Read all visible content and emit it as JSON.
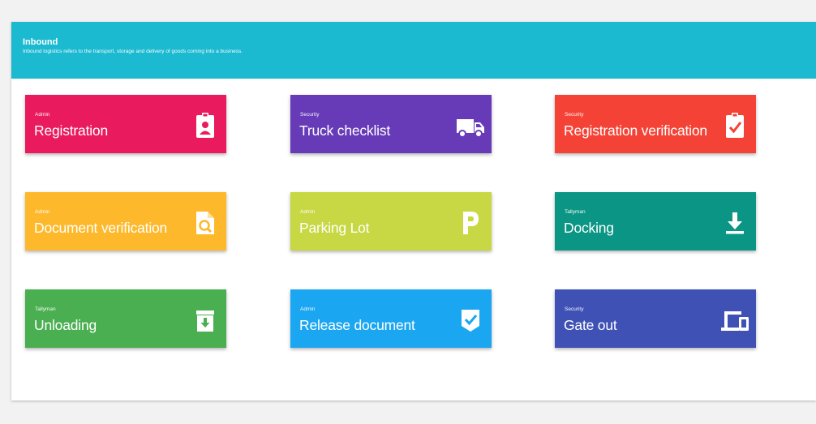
{
  "header": {
    "title": "Inbound",
    "subtitle": "Inbound logistics refers to the transport, storage and delivery of goods coming into a business."
  },
  "cards": [
    {
      "role": "Admin",
      "title": "Registration",
      "icon": "id-badge-icon",
      "color": "#e91a5d"
    },
    {
      "role": "Security",
      "title": "Truck checklist",
      "icon": "truck-icon",
      "color": "#673bb8"
    },
    {
      "role": "Security",
      "title": "Registration verification",
      "icon": "clipboard-check-icon",
      "color": "#f44336"
    },
    {
      "role": "Admin",
      "title": "Document verification",
      "icon": "document-search-icon",
      "color": "#fdb92b"
    },
    {
      "role": "Admin",
      "title": "Parking Lot",
      "icon": "parking-icon",
      "color": "#c7d844"
    },
    {
      "role": "Tallyman",
      "title": "Docking",
      "icon": "download-icon",
      "color": "#0a9584"
    },
    {
      "role": "Tallyman",
      "title": "Unloading",
      "icon": "archive-down-icon",
      "color": "#49af50"
    },
    {
      "role": "Admin",
      "title": "Release document",
      "icon": "shield-check-icon",
      "color": "#1ba6f1"
    },
    {
      "role": "Security",
      "title": "Gate out",
      "icon": "devices-icon",
      "color": "#3f51b5"
    }
  ]
}
